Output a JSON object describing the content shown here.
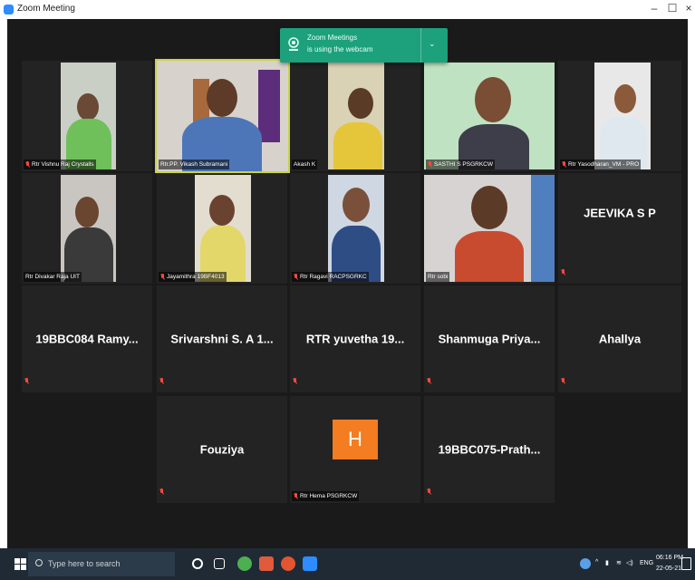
{
  "window": {
    "title": "Zoom Meeting",
    "minimize": "–",
    "maximize": "☐",
    "close": "×"
  },
  "notification": {
    "line1": "Zoom Meetings",
    "line2": "is using the webcam",
    "chevron": "⌄"
  },
  "participants_video": [
    {
      "name": "Rtr Vishnu Raj Crystalls",
      "muted": true
    },
    {
      "name": "Rtr.PP. Vikash Subramani",
      "muted": false
    },
    {
      "name": "Akash K",
      "muted": false
    },
    {
      "name": "SASTHI S PSGRKCW",
      "muted": true
    },
    {
      "name": "Rtr Yasodharan_VM - PRO",
      "muted": true
    },
    {
      "name": "Rtr Divakar Raja UIT",
      "muted": false
    },
    {
      "name": "Jayamithra 19BF4013",
      "muted": true
    },
    {
      "name": "Rtr Ragavi RACPSGRKC",
      "muted": true
    },
    {
      "name": "Rtr sobi",
      "muted": false
    }
  ],
  "participants_name_only": [
    {
      "name": "JEEVIKA S P"
    },
    {
      "name": "19BBC084 Ramy..."
    },
    {
      "name": "Srivarshni S. A 1..."
    },
    {
      "name": "RTR yuvetha 19..."
    },
    {
      "name": "Shanmuga Priya..."
    },
    {
      "name": "Ahallya"
    },
    {
      "name": "Fouziya"
    },
    {
      "name": "Rtr Hema PSGRKCW",
      "avatar_letter": "H"
    },
    {
      "name": "19BBC075-Prath..."
    }
  ],
  "taskbar": {
    "search_placeholder": "Type here to search",
    "lang": "ENG",
    "time": "06:16 PM",
    "date": "22-05-21"
  },
  "colors": {
    "accent_notification": "#1ca17c",
    "active_speaker_border": "#c9d34a",
    "avatar_bg": "#f47c21",
    "muted_icon": "#ff4a3d"
  }
}
